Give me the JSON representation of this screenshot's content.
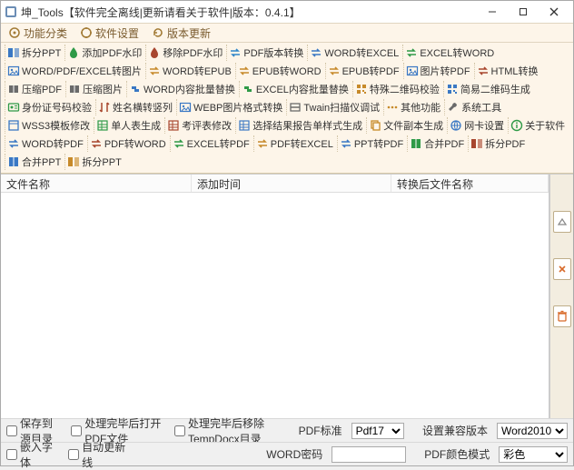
{
  "title": "坤_Tools【软件完全离线|更新请看关于软件|版本：0.4.1】",
  "menu": {
    "func": "功能分类",
    "settings": "软件设置",
    "update": "版本更新"
  },
  "toolbar": [
    {
      "icon": "split",
      "color": "#3a78c4",
      "label": "拆分PPT"
    },
    {
      "icon": "water",
      "color": "#2f9a47",
      "label": "添加PDF水印"
    },
    {
      "icon": "water",
      "color": "#a8462e",
      "label": "移除PDF水印"
    },
    {
      "icon": "swap",
      "color": "#2f86c9",
      "label": "PDF版本转换"
    },
    {
      "icon": "swap",
      "color": "#3a78c4",
      "label": "WORD转EXCEL"
    },
    {
      "icon": "swap",
      "color": "#2f9a47",
      "label": "EXCEL转WORD"
    },
    {
      "icon": "image",
      "color": "#3a78c4",
      "label": "WORD/PDF/EXCEL转图片"
    },
    {
      "icon": "swap",
      "color": "#c78a2a",
      "label": "WORD转EPUB"
    },
    {
      "icon": "swap",
      "color": "#c78a2a",
      "label": "EPUB转WORD"
    },
    {
      "icon": "swap",
      "color": "#c78a2a",
      "label": "EPUB转PDF"
    },
    {
      "icon": "image",
      "color": "#3a78c4",
      "label": "图片转PDF"
    },
    {
      "icon": "swap",
      "color": "#a8462e",
      "label": "HTML转换"
    },
    {
      "icon": "zip",
      "color": "#6b6b6b",
      "label": "压缩PDF"
    },
    {
      "icon": "zip",
      "color": "#6b6b6b",
      "label": "压缩图片"
    },
    {
      "icon": "replace",
      "color": "#3a78c4",
      "label": "WORD内容批量替换"
    },
    {
      "icon": "replace",
      "color": "#2f9a47",
      "label": "EXCEL内容批量替换"
    },
    {
      "icon": "qr",
      "color": "#c78a2a",
      "label": "特殊二维码校验"
    },
    {
      "icon": "qr",
      "color": "#3a78c4",
      "label": "简易二维码生成"
    },
    {
      "icon": "id",
      "color": "#2f9a47",
      "label": "身份证号码校验"
    },
    {
      "icon": "sort",
      "color": "#a8462e",
      "label": "姓名横转竖列"
    },
    {
      "icon": "image",
      "color": "#3a78c4",
      "label": "WEBP图片格式转换"
    },
    {
      "icon": "scan",
      "color": "#6b6b6b",
      "label": "Twain扫描仪调试"
    },
    {
      "icon": "more",
      "color": "#c78a2a",
      "label": "其他功能"
    },
    {
      "icon": "tool",
      "color": "#6b6b6b",
      "label": "系统工具"
    },
    {
      "icon": "template",
      "color": "#3a78c4",
      "label": "WSS3模板修改"
    },
    {
      "icon": "table",
      "color": "#2f9a47",
      "label": "单人表生成"
    },
    {
      "icon": "table",
      "color": "#a8462e",
      "label": "考评表修改"
    },
    {
      "icon": "table",
      "color": "#3a78c4",
      "label": "选择结果报告单样式生成"
    },
    {
      "icon": "copy",
      "color": "#c78a2a",
      "label": "文件副本生成"
    },
    {
      "icon": "net",
      "color": "#3a78c4",
      "label": "网卡设置"
    },
    {
      "icon": "info",
      "color": "#2f9a47",
      "label": "关于软件"
    },
    {
      "icon": "swap",
      "color": "#3a78c4",
      "label": "WORD转PDF"
    },
    {
      "icon": "swap",
      "color": "#a8462e",
      "label": "PDF转WORD"
    },
    {
      "icon": "swap",
      "color": "#2f9a47",
      "label": "EXCEL转PDF"
    },
    {
      "icon": "swap",
      "color": "#c78a2a",
      "label": "PDF转EXCEL"
    },
    {
      "icon": "swap",
      "color": "#3a78c4",
      "label": "PPT转PDF"
    },
    {
      "icon": "merge",
      "color": "#2f9a47",
      "label": "合并PDF"
    },
    {
      "icon": "split",
      "color": "#a8462e",
      "label": "拆分PDF"
    },
    {
      "icon": "merge",
      "color": "#3a78c4",
      "label": "合并PPT"
    },
    {
      "icon": "split",
      "color": "#c78a2a",
      "label": "拆分PPT"
    }
  ],
  "columns": {
    "c1": "文件名称",
    "c2": "添加时间",
    "c3": "转换后文件名称"
  },
  "side": {
    "up": "△",
    "del": "x",
    "trash": "trash"
  },
  "opts": {
    "save_source": "保存到源目录",
    "open_after": "处理完毕后打开PDF文件",
    "remove_temp": "处理完毕后移除TempDocx目录",
    "pdf_std_label": "PDF标准",
    "pdf_std_value": "Pdf17",
    "compat_label": "设置兼容版本",
    "compat_value": "Word2010",
    "embed_font": "嵌入字体",
    "auto_update": "自动更新线",
    "word_pwd_label": "WORD密码",
    "word_pwd_value": "",
    "color_mode_label": "PDF颜色模式",
    "color_mode_value": "彩色"
  }
}
